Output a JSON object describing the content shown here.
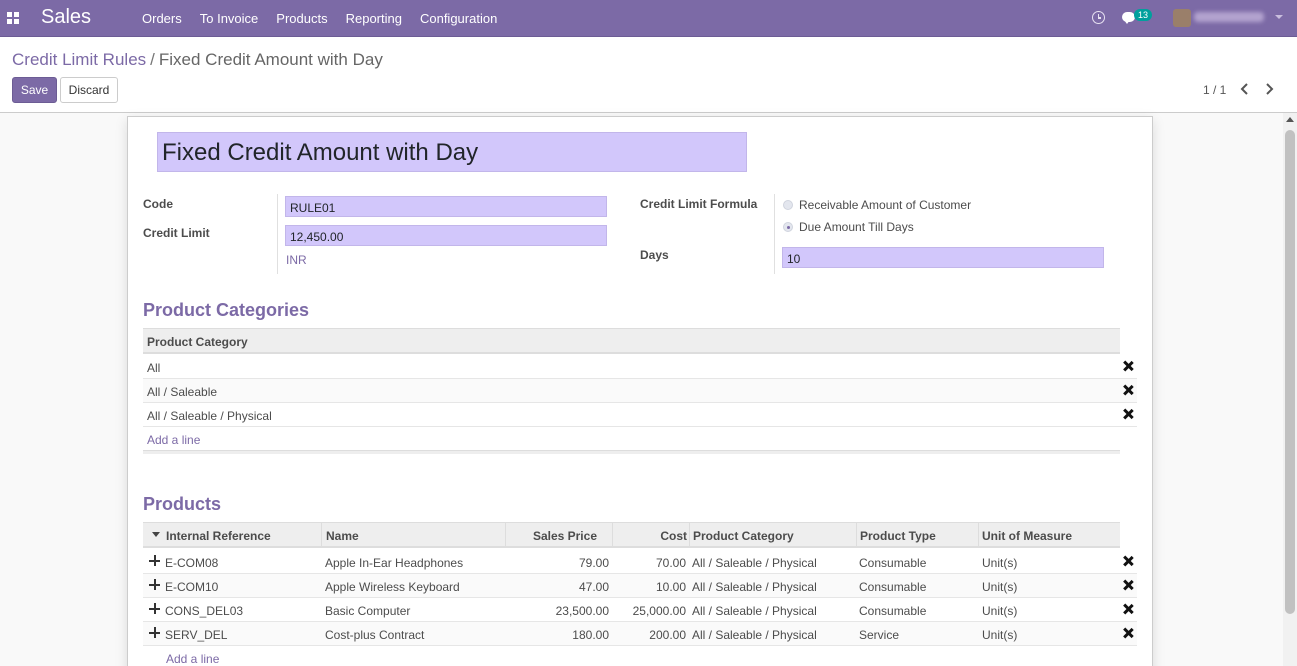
{
  "navbar": {
    "app_name": "Sales",
    "menu": [
      "Orders",
      "To Invoice",
      "Products",
      "Reporting",
      "Configuration"
    ],
    "chat_count": "13",
    "brand_color": "#7c6aa6"
  },
  "breadcrumb": {
    "parent": "Credit Limit Rules",
    "separator": "/",
    "current": "Fixed Credit Amount with Day"
  },
  "buttons": {
    "save": "Save",
    "discard": "Discard"
  },
  "pager": {
    "value": "1 / 1"
  },
  "form": {
    "name": "Fixed Credit Amount with Day",
    "code_label": "Code",
    "code": "RULE01",
    "credit_limit_label": "Credit Limit",
    "credit_limit": "12,450.00",
    "currency": "INR",
    "formula_label": "Credit Limit Formula",
    "formula_options": [
      "Receivable Amount of Customer",
      "Due Amount Till Days"
    ],
    "formula_selected": "Due Amount Till Days",
    "days_label": "Days",
    "days": "10"
  },
  "categories": {
    "title": "Product Categories",
    "header": "Product Category",
    "rows": [
      "All",
      "All / Saleable",
      "All / Saleable / Physical"
    ],
    "add_line": "Add a line"
  },
  "products": {
    "title": "Products",
    "headers": {
      "internal_reference": "Internal Reference",
      "name": "Name",
      "sales_price": "Sales Price",
      "cost": "Cost",
      "product_category": "Product Category",
      "product_type": "Product Type",
      "uom": "Unit of Measure"
    },
    "rows": [
      {
        "ref": "E-COM08",
        "name": "Apple In-Ear Headphones",
        "price": "79.00",
        "cost": "70.00",
        "category": "All / Saleable / Physical",
        "type": "Consumable",
        "uom": "Unit(s)"
      },
      {
        "ref": "E-COM10",
        "name": "Apple Wireless Keyboard",
        "price": "47.00",
        "cost": "10.00",
        "category": "All / Saleable / Physical",
        "type": "Consumable",
        "uom": "Unit(s)"
      },
      {
        "ref": "CONS_DEL03",
        "name": "Basic Computer",
        "price": "23,500.00",
        "cost": "25,000.00",
        "category": "All / Saleable / Physical",
        "type": "Consumable",
        "uom": "Unit(s)"
      },
      {
        "ref": "SERV_DEL",
        "name": "Cost-plus Contract",
        "price": "180.00",
        "cost": "200.00",
        "category": "All / Saleable / Physical",
        "type": "Service",
        "uom": "Unit(s)"
      }
    ],
    "add_line": "Add a line"
  }
}
